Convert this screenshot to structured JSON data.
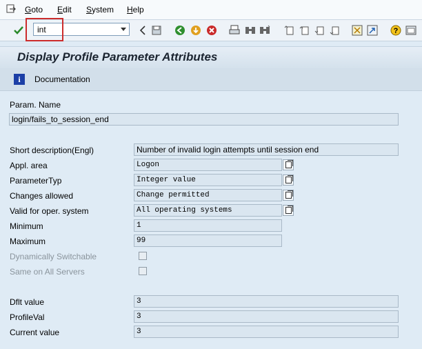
{
  "menu": {
    "items": [
      {
        "label": "Goto",
        "underline": "G",
        "rest": "oto"
      },
      {
        "label": "Edit",
        "underline": "E",
        "rest": "dit"
      },
      {
        "label": "System",
        "underline": "S",
        "rest": "ystem"
      },
      {
        "label": "Help",
        "underline": "H",
        "rest": "elp"
      }
    ]
  },
  "toolbar": {
    "command_value": "int",
    "icons": [
      "enter-icon",
      "back-icon",
      "save-icon",
      "green-back-icon",
      "exit-icon",
      "cancel-icon",
      "print-icon",
      "find-icon",
      "find-next-icon",
      "first-page-icon",
      "previous-page-icon",
      "next-page-icon",
      "last-page-icon",
      "create-session-icon",
      "shortcut-icon",
      "help-icon",
      "customize-icon"
    ]
  },
  "title": "Display Profile Parameter Attributes",
  "app_toolbar": {
    "documentation_label": "Documentation"
  },
  "form": {
    "param_name_label": "Param. Name",
    "param_name_value": "login/fails_to_session_end",
    "short_desc_label": "Short description(Engl)",
    "short_desc_value": "Number of invalid login attempts until session end",
    "appl_area_label": "Appl. area",
    "appl_area_value": "Logon",
    "param_type_label": "ParameterTyp",
    "param_type_value": "Integer value",
    "changes_allowed_label": "Changes allowed",
    "changes_allowed_value": "Change permitted",
    "valid_os_label": "Valid for oper. system",
    "valid_os_value": "All operating systems",
    "minimum_label": "Minimum",
    "minimum_value": "1",
    "maximum_label": "Maximum",
    "maximum_value": "99",
    "dyn_switch_label": "Dynamically Switchable",
    "same_servers_label": "Same on All Servers",
    "dflt_label": "Dflt value",
    "dflt_value": "3",
    "profileval_label": "ProfileVal",
    "profileval_value": "3",
    "current_label": "Current value",
    "current_value": "3"
  }
}
